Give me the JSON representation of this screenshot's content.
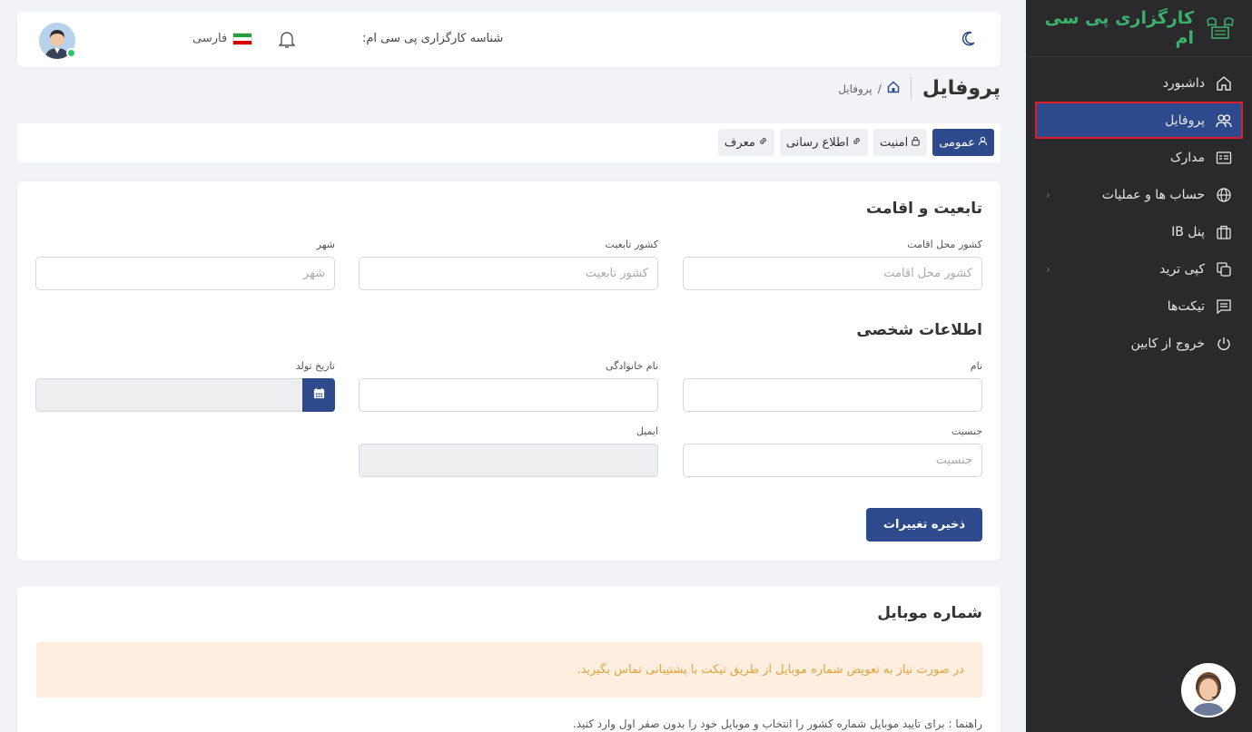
{
  "brand": {
    "name": "کارگزاری پی سی ام"
  },
  "sidebar": {
    "items": [
      {
        "label": "داشبورد",
        "icon": "home-icon"
      },
      {
        "label": "پروفایل",
        "icon": "users-icon",
        "active": true
      },
      {
        "label": "مدارک",
        "icon": "id-card-icon"
      },
      {
        "label": "حساب ها و عملیات",
        "icon": "globe-icon",
        "has_children": true
      },
      {
        "label": "پنل IB",
        "icon": "briefcase-icon"
      },
      {
        "label": "کپی ترید",
        "icon": "copy-icon",
        "has_children": true
      },
      {
        "label": "تیکت‌ها",
        "icon": "message-icon"
      },
      {
        "label": "خروج از کابین",
        "icon": "power-icon"
      }
    ],
    "chevron": "‹"
  },
  "topbar": {
    "agent_id_label": "شناسه کارگزاری پی سی ام:",
    "language": "فارسی"
  },
  "page": {
    "title": "پروفایل",
    "breadcrumb_sep": "/",
    "breadcrumb_current": "پروفایل"
  },
  "tabs": [
    {
      "label": "عمومی",
      "active": true
    },
    {
      "label": "امنیت"
    },
    {
      "label": "اطلاع رسانی"
    },
    {
      "label": "معرف"
    }
  ],
  "residence": {
    "title": "تابعیت و اقامت",
    "country_residence_label": "کشور محل اقامت",
    "country_residence_placeholder": "کشور محل اقامت",
    "country_citizenship_label": "کشور تابعیت",
    "country_citizenship_placeholder": "کشور تابعیت",
    "city_label": "شهر",
    "city_placeholder": "شهر"
  },
  "personal": {
    "title": "اطلاعات شخصی",
    "first_name_label": "نام",
    "last_name_label": "نام خانوادگی",
    "birth_date_label": "تاریخ تولد",
    "gender_label": "جنسیت",
    "gender_placeholder": "جنسیت",
    "email_label": "ایمیل"
  },
  "save_button": "ذخیره تغییرات",
  "mobile": {
    "title": "شماره موبایل",
    "alert": "در صورت نیاز به تعویض شماره موبایل از طریق تیکت با پشتیبانی تماس بگیرید.",
    "hint": "راهنما : برای تایید موبایل شماره کشور را انتخاب و موبایل خود را بدون صفر اول وارد کنید."
  },
  "colors": {
    "primary": "#2c4a8c",
    "sidebar_bg": "#2a2a2c",
    "brand_green": "#3bb26a",
    "alert_bg": "#fdeee0",
    "alert_text": "#e6a33a",
    "active_outline": "#e01e2b"
  }
}
